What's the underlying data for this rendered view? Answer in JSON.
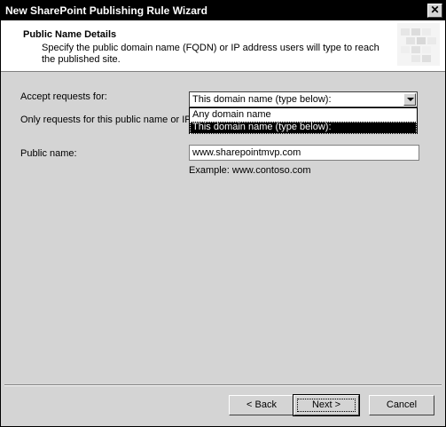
{
  "window": {
    "title": "New SharePoint Publishing Rule Wizard",
    "close_glyph": "✕"
  },
  "header": {
    "title": "Public Name Details",
    "description": "Specify the public domain name (FQDN) or IP address users will type to reach the published site."
  },
  "accept": {
    "label": "Accept requests for:",
    "selected": "This domain name (type below):",
    "options": [
      "Any domain name",
      "This domain name (type below):"
    ]
  },
  "only_requests": {
    "label": "Only requests for this public name or IP"
  },
  "public_name": {
    "label": "Public name:",
    "value": "www.sharepointmvp.com",
    "example": "Example: www.contoso.com"
  },
  "buttons": {
    "back": "< Back",
    "next": "Next >",
    "cancel": "Cancel"
  }
}
